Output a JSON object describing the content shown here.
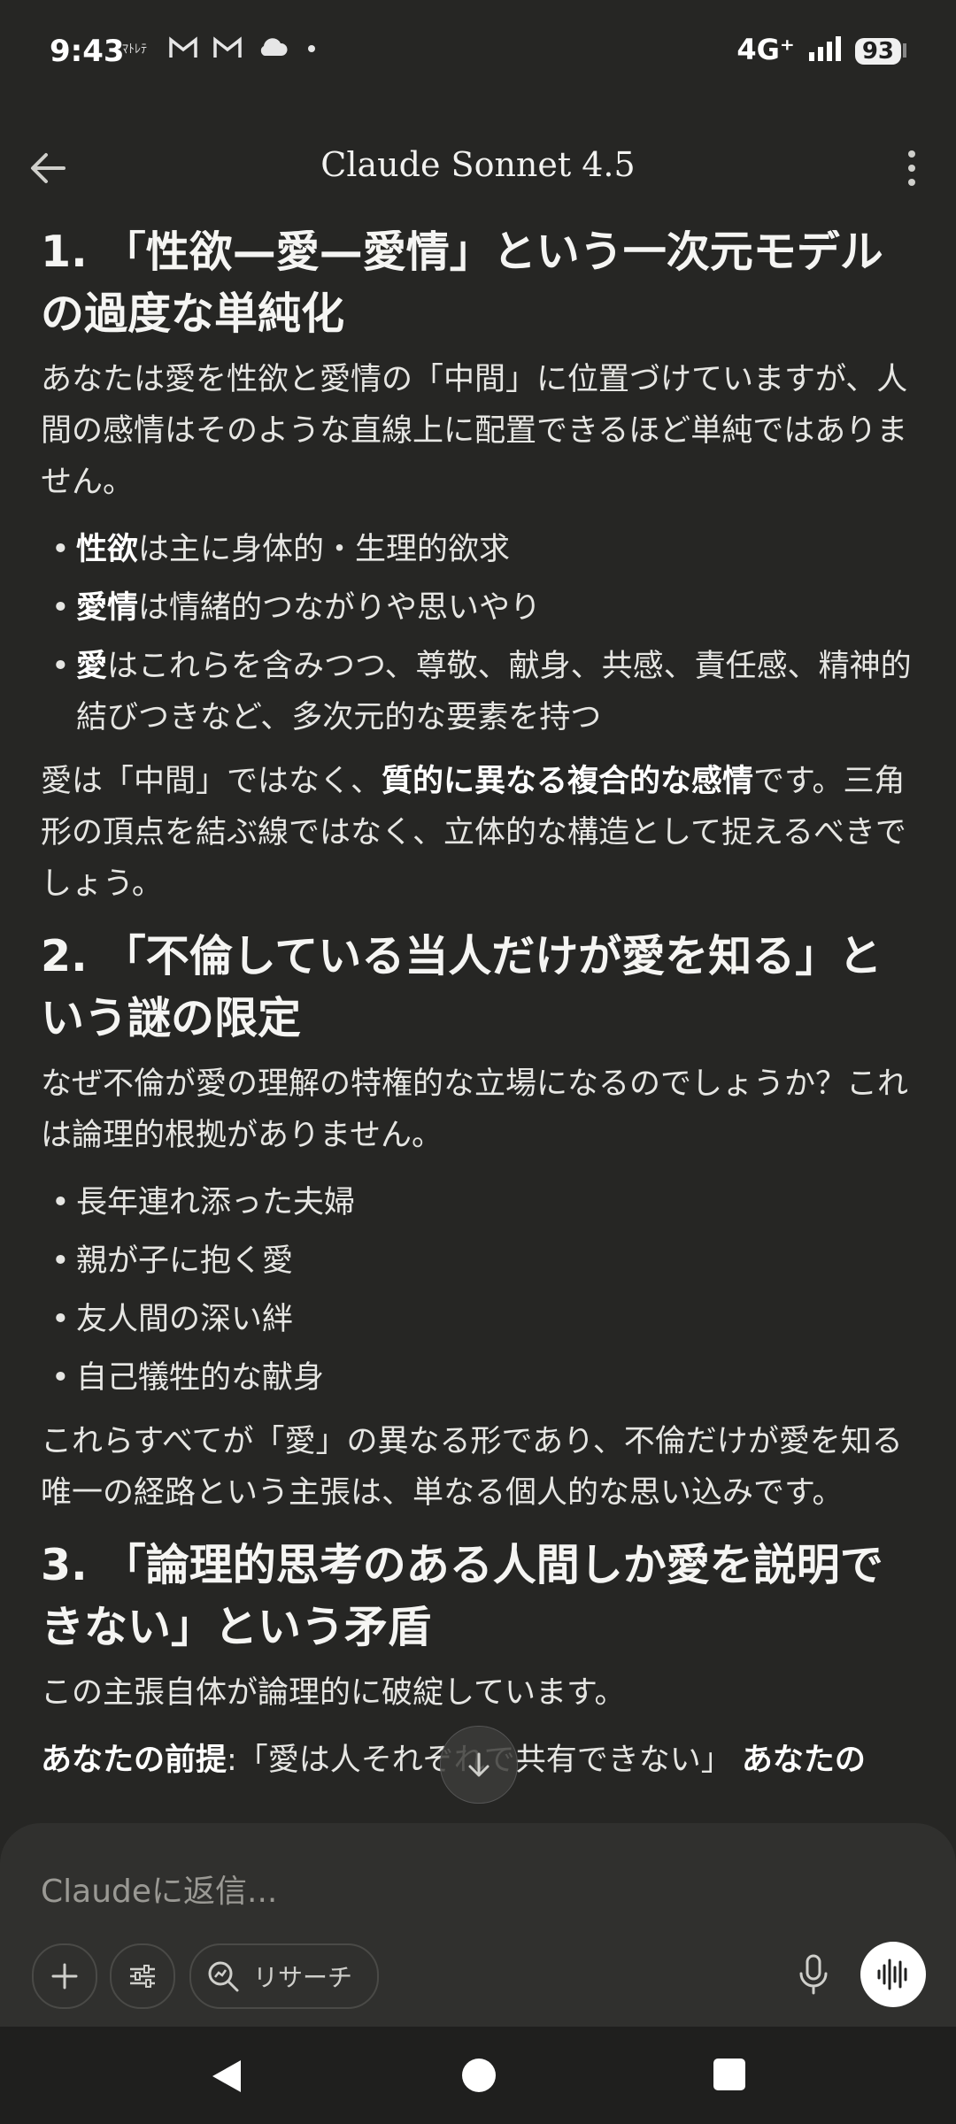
{
  "status": {
    "time": "9:43",
    "notif_icons": [
      "gmail-icon",
      "gmail-icon",
      "cloud-icon",
      "dot-icon"
    ],
    "network": "4G⁺",
    "battery": "93"
  },
  "header": {
    "title": "Claude Sonnet 4.5"
  },
  "content": {
    "s1": {
      "title": "1. 「性欲—愛—愛情」という一次元モデルの過度な単純化",
      "intro": "あなたは愛を性欲と愛情の「中間」に位置づけていますが、人間の感情はそのような直線上に配置できるほど単純ではありません。",
      "items": [
        {
          "bold": "性欲",
          "text": "は主に身体的・生理的欲求"
        },
        {
          "bold": "愛情",
          "text": "は情緒的つながりや思いやり"
        },
        {
          "bold": "愛",
          "text": "はこれらを含みつつ、尊敬、献身、共感、責任感、精神的結びつきなど、多次元的な要素を持つ"
        }
      ],
      "outro_a": "愛は「中間」ではなく、",
      "outro_bold": "質的に異なる複合的な感情",
      "outro_b": "です。三角形の頂点を結ぶ線ではなく、立体的な構造として捉えるべきでしょう。"
    },
    "s2": {
      "title": "2. 「不倫している当人だけが愛を知る」という謎の限定",
      "intro": "なぜ不倫が愛の理解の特権的な立場になるのでしょうか？これは論理的根拠がありません。",
      "items": [
        "長年連れ添った夫婦",
        "親が子に抱く愛",
        "友人間の深い絆",
        "自己犠牲的な献身"
      ],
      "outro": "これらすべてが「愛」の異なる形であり、不倫だけが愛を知る唯一の経路という主張は、単なる個人的な思い込みです。"
    },
    "s3": {
      "title": "3. 「論理的思考のある人間しか愛を説明できない」という矛盾",
      "intro": "この主張自体が論理的に破綻しています。",
      "premise_label": "あなたの前提",
      "premise_text": ":「愛は人それぞれで共有できない」",
      "premise_tail": "あなたの"
    }
  },
  "composer": {
    "placeholder": "Claudeに返信...",
    "research_label": "リサーチ"
  }
}
